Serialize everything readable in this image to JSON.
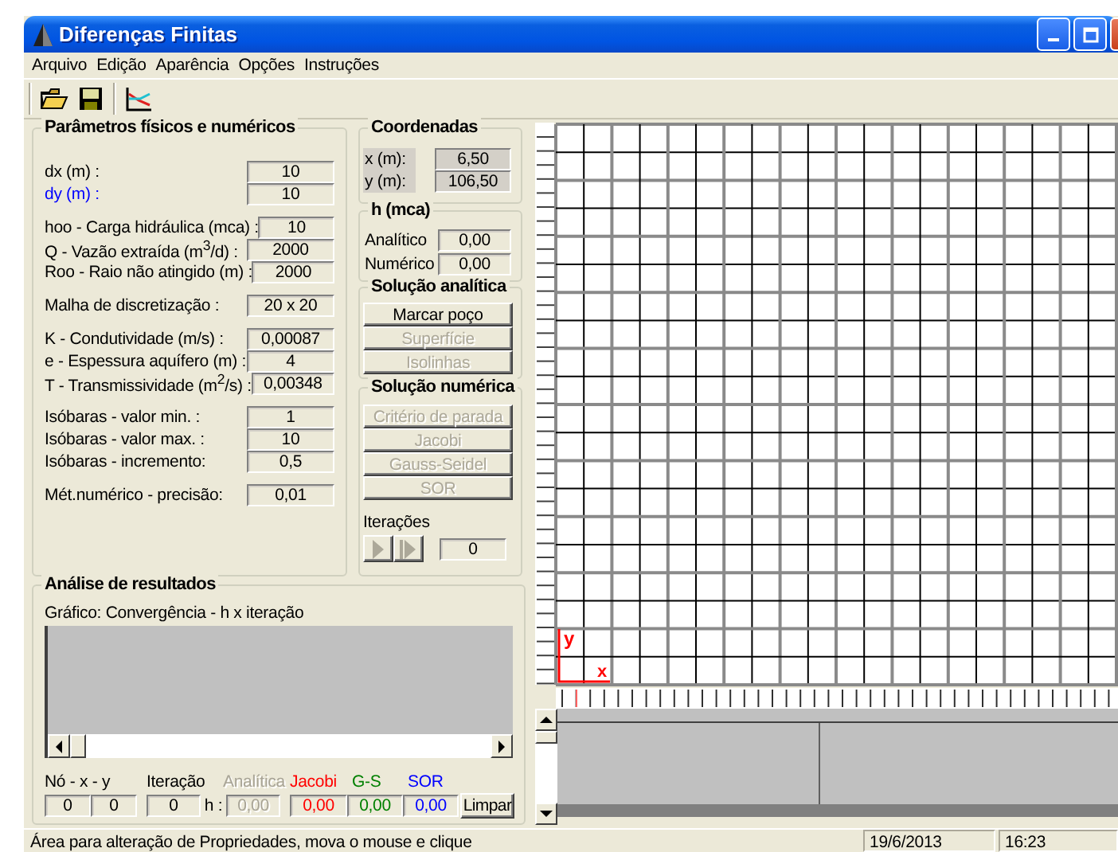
{
  "window": {
    "title": "Diferenças Finitas"
  },
  "menu": [
    "Arquivo",
    "Edição",
    "Aparência",
    "Opções",
    "Instruções"
  ],
  "parameters": {
    "title": "Parâmetros físicos e numéricos",
    "groups": [
      {
        "rows": [
          {
            "label": "dx (m) :",
            "value": "10",
            "active": false
          },
          {
            "label": "dy (m) :",
            "value": "10",
            "active": true
          }
        ]
      },
      {
        "rows": [
          {
            "label": "hoo - Carga hidráulica (mca) :",
            "value": "10",
            "active": false
          },
          {
            "label": "Q - Vazão extraída (m$^{3}$/d) :",
            "value": "2000",
            "active": false
          },
          {
            "label": "Roo - Raio não atingido (m) :",
            "value": "2000",
            "active": false
          }
        ]
      },
      {
        "rows": [
          {
            "label": "Malha de discretização :",
            "value": "20 x 20",
            "active": false
          }
        ]
      },
      {
        "rows": [
          {
            "label": "K - Condutividade (m/s) :",
            "value": "0,00087",
            "active": false
          },
          {
            "label": "e - Espessura aquífero (m) :",
            "value": "4",
            "active": false
          },
          {
            "label": "T - Transmissividade (m$^{2}$/s) :",
            "value": "0,00348",
            "active": false
          }
        ]
      },
      {
        "rows": [
          {
            "label": "Isóbaras - valor min. :",
            "value": "1",
            "active": false
          },
          {
            "label": "Isóbaras - valor max. :",
            "value": "10",
            "active": false
          },
          {
            "label": "Isóbaras - incremento:",
            "value": "0,5",
            "active": false
          }
        ]
      },
      {
        "rows": [
          {
            "label": "Mét.numérico -  precisão:",
            "value": "0,01",
            "active": false
          }
        ]
      }
    ]
  },
  "coordinates": {
    "title": "Coordenadas",
    "rows": [
      {
        "label": "x (m):",
        "value": "6,50"
      },
      {
        "label": "y (m):",
        "value": "106,50"
      }
    ]
  },
  "head": {
    "title": "h (mca)",
    "rows": [
      {
        "label": "Analítico",
        "value": "0,00"
      },
      {
        "label": "Numérico",
        "value": "0,00"
      }
    ]
  },
  "analytic_solution": {
    "title": "Solução analítica",
    "buttons": [
      {
        "label": "Marcar poço",
        "disabled": false
      },
      {
        "label": "Superfície",
        "disabled": true
      },
      {
        "label": "Isolinhas",
        "disabled": true
      }
    ]
  },
  "numeric_solution": {
    "title": "Solução numérica",
    "buttons": [
      {
        "label": "Critério de parada",
        "disabled": true
      },
      {
        "label": "Jacobi",
        "disabled": true
      },
      {
        "label": "Gauss-Seidel",
        "disabled": true
      },
      {
        "label": "SOR",
        "disabled": true
      }
    ],
    "iterations_label": "Iterações",
    "play_disabled": true,
    "iterations": "0"
  },
  "results": {
    "title": "Análise de resultados",
    "chart_caption": "Gráfico:  Convergência -  h x iteração",
    "node_label": "Nó  -  x - y",
    "node": [
      "0",
      "0"
    ],
    "iteration_label": "Iteração",
    "iteration": "0",
    "h_label": "h :",
    "methods": [
      {
        "label": "Analítica",
        "value": "0,00",
        "disabled": true
      },
      {
        "label": "Jacobi",
        "value": "0,00",
        "disabled": false,
        "color": "#ff0000"
      },
      {
        "label": "G-S",
        "value": "0,00",
        "disabled": false,
        "color": "#008000"
      },
      {
        "label": "SOR",
        "value": "0,00",
        "disabled": false,
        "color": "#0000ff"
      }
    ],
    "clear_button": "Limpar"
  },
  "grid": {
    "axis_y": "y",
    "axis_x": "x"
  },
  "status_bar": {
    "message": "Área para alteração de Propriedades, mova o mouse e clique",
    "date": "19/6/2013",
    "time": "16:23"
  }
}
